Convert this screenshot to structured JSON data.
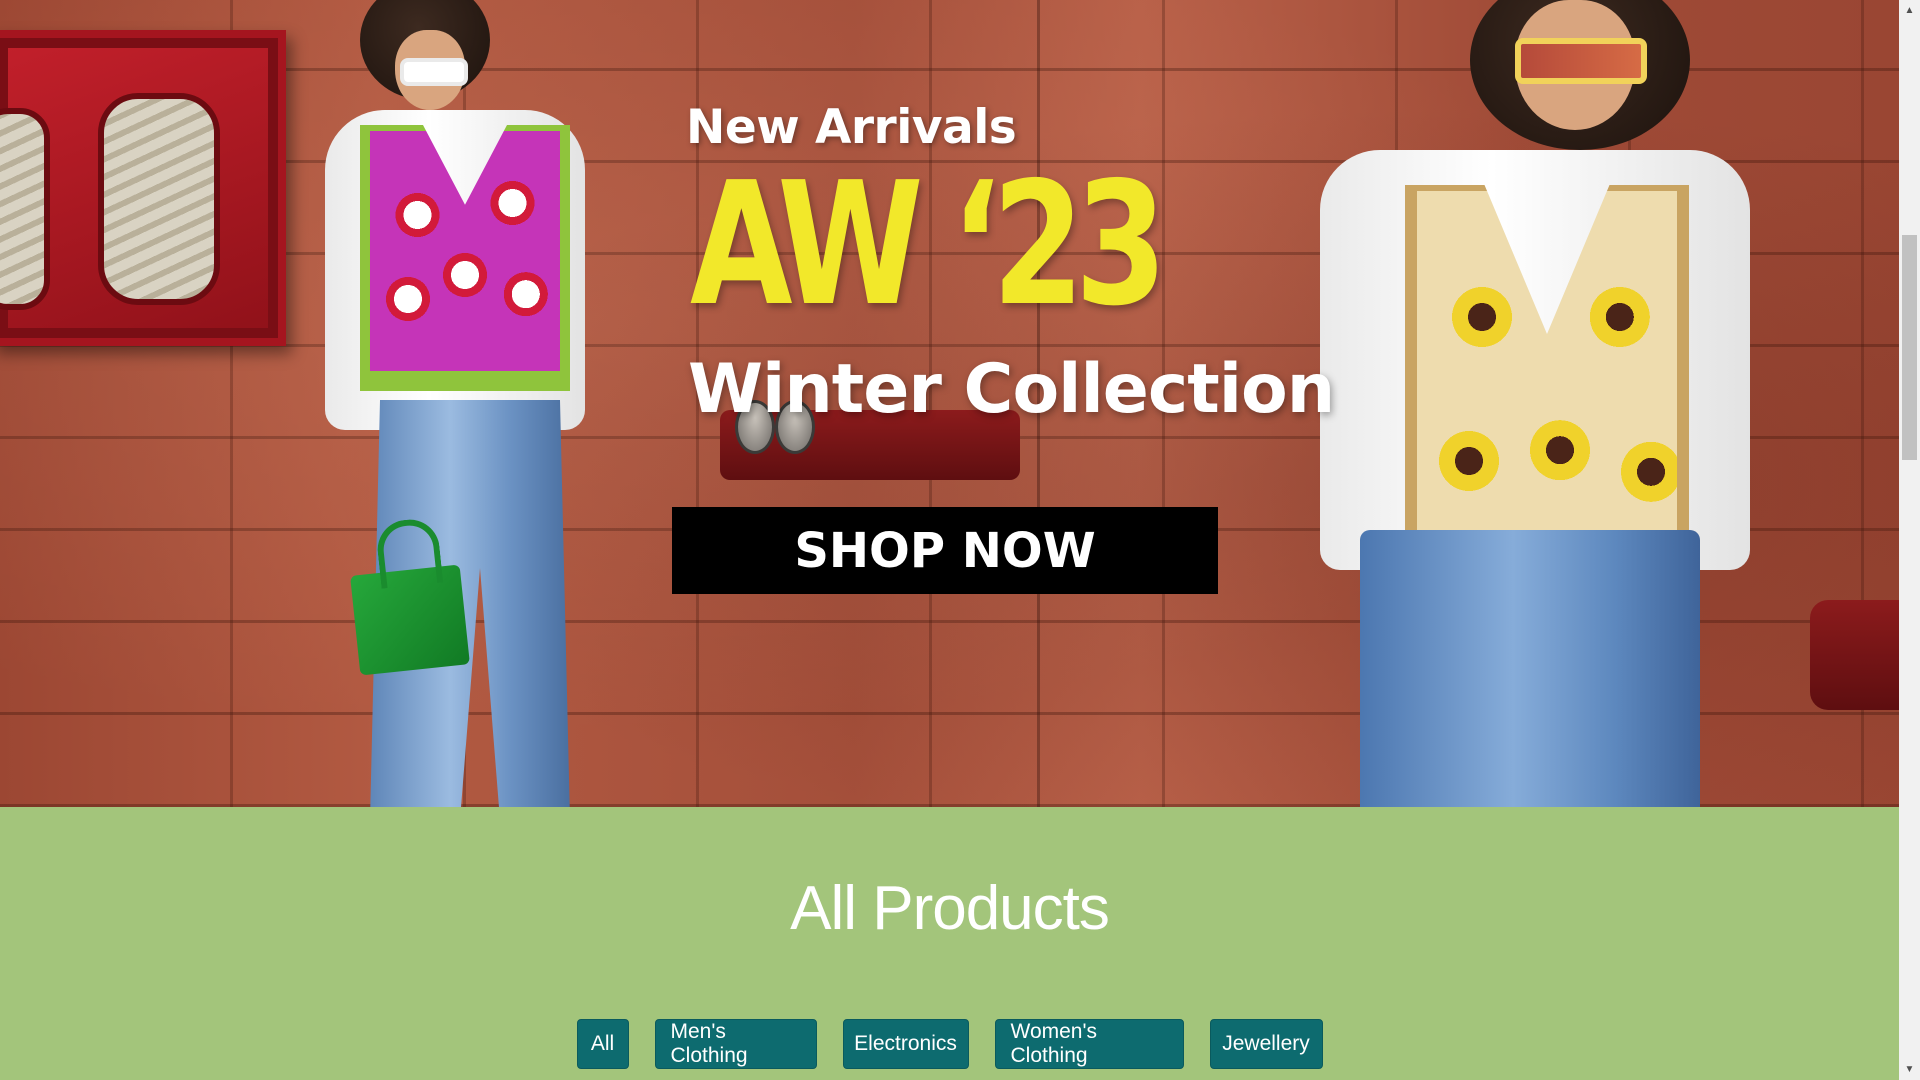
{
  "hero": {
    "headline_small": "New Arrivals",
    "headline_big": "AW ‘23",
    "headline_sub": "Winter Collection",
    "cta_label": "SHOP NOW",
    "colors": {
      "headline_big": "#f2e82a",
      "cta_bg": "#000000",
      "cta_text": "#ffffff"
    }
  },
  "products": {
    "title": "All Products",
    "filters": [
      {
        "label": "All"
      },
      {
        "label": "Men's Clothing"
      },
      {
        "label": "Electronics"
      },
      {
        "label": "Women's Clothing"
      },
      {
        "label": "Jewellery"
      }
    ],
    "colors": {
      "section_bg": "#a3c57b",
      "button_bg": "#0d6b6f"
    }
  },
  "scrollbar": {
    "up_icon": "triangle-up-icon",
    "down_icon": "triangle-down-icon"
  }
}
